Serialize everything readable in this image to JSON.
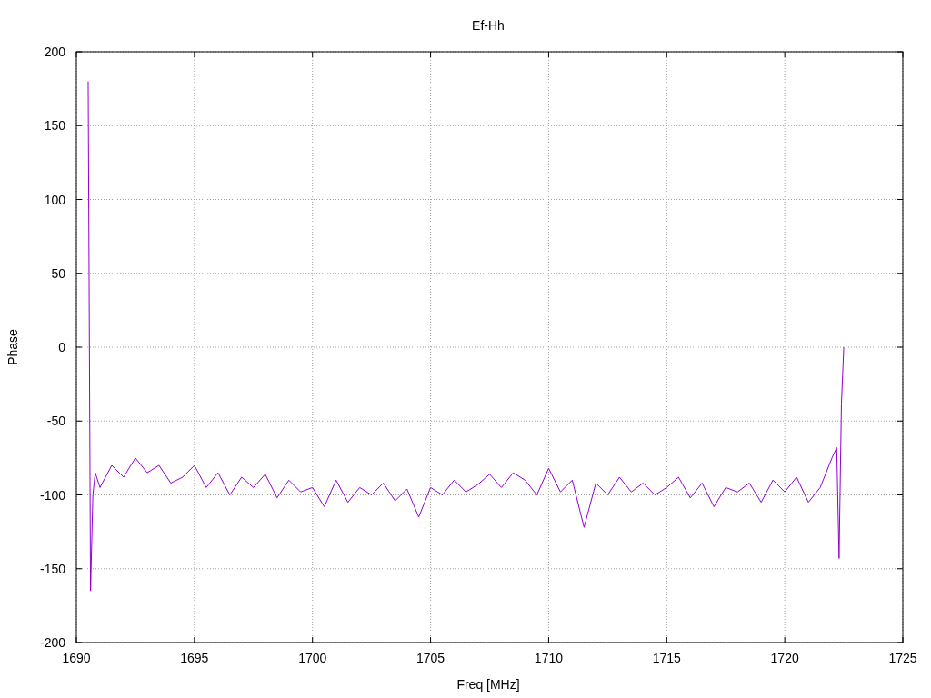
{
  "chart": {
    "chart_data": {
      "type": "line",
      "title": "Ef-Hh",
      "xlabel": "Freq [MHz]",
      "ylabel": "Phase",
      "grid": true,
      "xlim": [
        1690,
        1725
      ],
      "ylim": [
        -200,
        200
      ],
      "xticks": [
        1690,
        1695,
        1700,
        1705,
        1710,
        1715,
        1720,
        1725
      ],
      "yticks": [
        -200,
        -150,
        -100,
        -50,
        0,
        50,
        100,
        150,
        200
      ],
      "x": [
        1690.5,
        1690.55,
        1690.6,
        1690.7,
        1690.8,
        1691,
        1691.5,
        1692,
        1692.5,
        1693,
        1693.5,
        1694,
        1694.5,
        1695,
        1695.5,
        1696,
        1696.5,
        1697,
        1697.5,
        1698,
        1698.5,
        1699,
        1699.5,
        1700,
        1700.5,
        1701,
        1701.5,
        1702,
        1702.5,
        1703,
        1703.5,
        1704,
        1704.5,
        1705,
        1705.5,
        1706,
        1706.5,
        1707,
        1707.5,
        1708,
        1708.5,
        1709,
        1709.5,
        1710,
        1710.5,
        1711,
        1711.5,
        1712,
        1712.5,
        1713,
        1713.5,
        1714,
        1714.5,
        1715,
        1715.5,
        1716,
        1716.5,
        1717,
        1717.5,
        1718,
        1718.5,
        1719,
        1719.5,
        1720,
        1720.5,
        1721,
        1721.5,
        1722,
        1722.2,
        1722.3,
        1722.4,
        1722.5
      ],
      "series": [
        {
          "color": "#9400d3",
          "values": [
            180,
            8,
            -165,
            -100,
            -85,
            -95,
            -80,
            -88,
            -75,
            -85,
            -80,
            -92,
            -88,
            -80,
            -95,
            -85,
            -100,
            -88,
            -95,
            -86,
            -102,
            -90,
            -98,
            -95,
            -108,
            -90,
            -105,
            -95,
            -100,
            -92,
            -104,
            -96,
            -115,
            -95,
            -100,
            -90,
            -98,
            -93,
            -86,
            -95,
            -85,
            -90,
            -100,
            -82,
            -98,
            -90,
            -122,
            -92,
            -100,
            -88,
            -98,
            -92,
            -100,
            -95,
            -88,
            -102,
            -92,
            -108,
            -95,
            -98,
            -92,
            -105,
            -90,
            -98,
            -88,
            -105,
            -95,
            -75,
            -68,
            -143,
            -38,
            0
          ]
        }
      ]
    }
  }
}
